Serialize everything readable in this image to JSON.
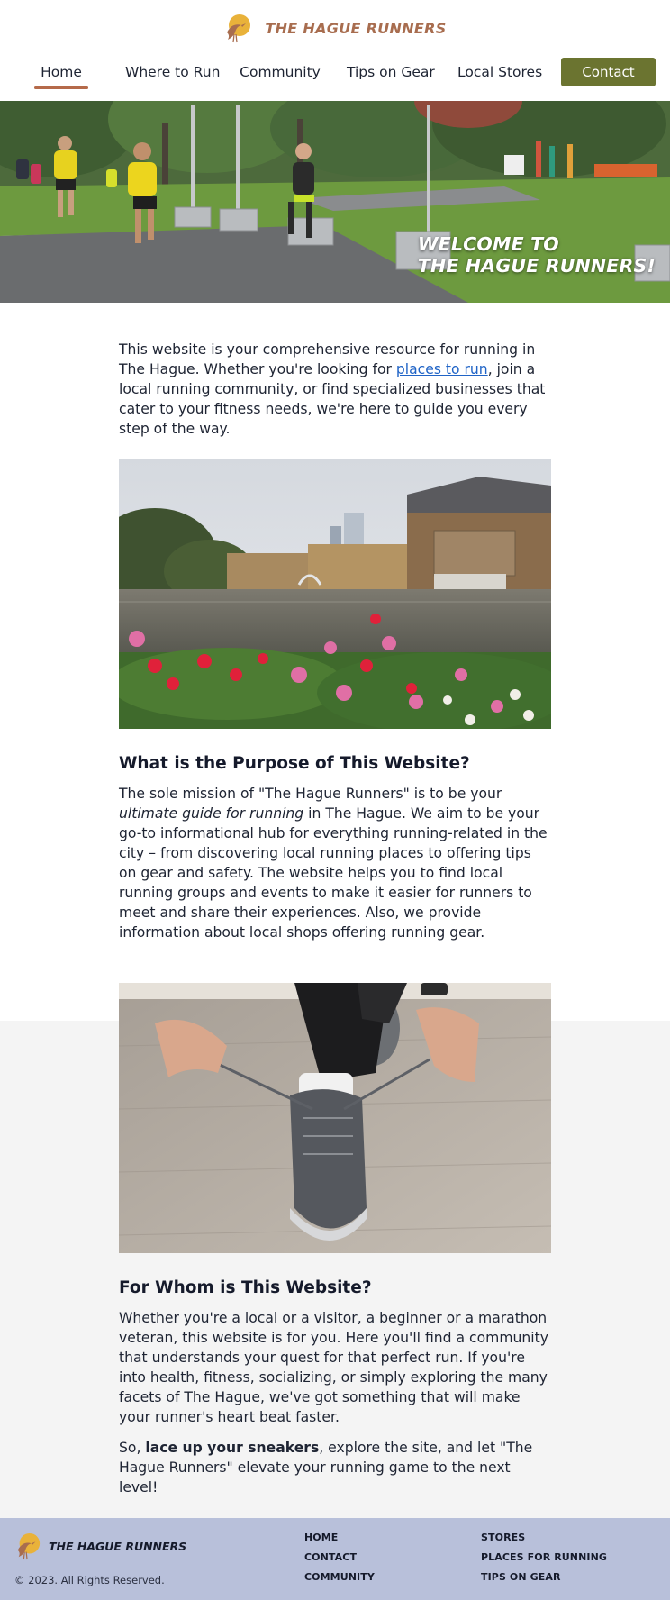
{
  "brand": {
    "name": "THE HAGUE RUNNERS",
    "logo_icon": "bird-sun-icon"
  },
  "nav": {
    "items": [
      {
        "label": "Home",
        "active": true
      },
      {
        "label": "Where to Run",
        "active": false
      },
      {
        "label": "Community",
        "active": false
      },
      {
        "label": "Tips on Gear",
        "active": false
      },
      {
        "label": "Local Stores",
        "active": false
      }
    ],
    "contact_label": "Contact"
  },
  "hero": {
    "title_line1": "WELCOME TO",
    "title_line2": "THE HAGUE RUNNERS!"
  },
  "intro": {
    "text_before_link": "This website is your comprehensive resource for running in The Hague. Whether you're looking for ",
    "link_text": "places to run",
    "text_after_link": ", join a local running community, or find specialized businesses that cater to your fitness needs, we're here to guide you every step of the way."
  },
  "purpose": {
    "heading": "What is the Purpose of This Website?",
    "text_before_em": "The sole mission of \"The Hague Runners\" is to be your ",
    "em_text": "ultimate guide for running",
    "text_after_em": " in The Hague. We aim to be your go-to informational hub for everything running-related in the city – from discovering local running places to offering tips on gear and safety. The website helps you to find local running groups and events to make it easier for runners to meet and share their experiences. Also, we provide information about local shops offering running gear."
  },
  "audience": {
    "heading": "For Whom is This Website?",
    "paragraph1": "Whether you're a local or a visitor, a beginner or a marathon veteran, this website is for you. Here you'll find a community that understands your quest for that perfect run. If you're into health, fitness, socializing, or simply exploring the many facets of The Hague, we've got something that will make your runner's heart beat faster.",
    "p2_before_bold": "So, ",
    "p2_bold": "lace up your sneakers",
    "p2_after_bold": ", explore the site, and let \"The Hague Runners\" elevate your running game to the next level!"
  },
  "footer": {
    "brand_name": "THE HAGUE RUNNERS",
    "copyright": "© 2023. All Rights Reserved.",
    "col1": [
      "HOME",
      "CONTACT",
      "COMMUNITY"
    ],
    "col2": [
      "STORES",
      "PLACES FOR RUNNING",
      "TIPS ON GEAR"
    ]
  },
  "colors": {
    "brand_text": "#a86d4f",
    "contact_button": "#6b7430",
    "nav_active_underline": "#b56a4a",
    "link": "#1f63c6",
    "footer_bg": "#b8c0da",
    "section_gray": "#f4f4f4"
  }
}
